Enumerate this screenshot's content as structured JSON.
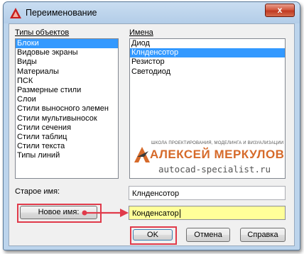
{
  "window": {
    "title": "Переименование",
    "close_label": "x"
  },
  "object_types": {
    "label": "Типы объектов",
    "items": [
      "Блоки",
      "Видовые экраны",
      "Виды",
      "Материалы",
      "ПСК",
      "Размерные стили",
      "Слои",
      "Стили выносного элемен",
      "Стили мультивыносок",
      "Стили сечения",
      "Стили таблиц",
      "Стили текста",
      "Типы линий"
    ],
    "selected_index": 0
  },
  "names": {
    "label": "Имена",
    "items": [
      "Диод",
      "Клнденсотор",
      "Резистор",
      "Светодиод"
    ],
    "selected_index": 1
  },
  "watermark": {
    "tagline": "ШКОЛА ПРОЕКТИРОВАНИЯ, МОДЕЛИНГА И ВИЗУАЛИЗАЦИИ",
    "name": "АЛЕКСЕЙ МЕРКУЛОВ",
    "url": "autocad-specialist.ru",
    "accent_color": "#d66a2a"
  },
  "old_name": {
    "label": "Старое имя:",
    "value": "Клнденсотор"
  },
  "new_name": {
    "button_label": "Новое имя:",
    "value": "Конденсатор"
  },
  "buttons": {
    "ok": "OK",
    "cancel": "Отмена",
    "help": "Справка"
  },
  "colors": {
    "selection": "#3399ff",
    "highlight": "#ffff99",
    "annotation": "#e03a4a"
  }
}
